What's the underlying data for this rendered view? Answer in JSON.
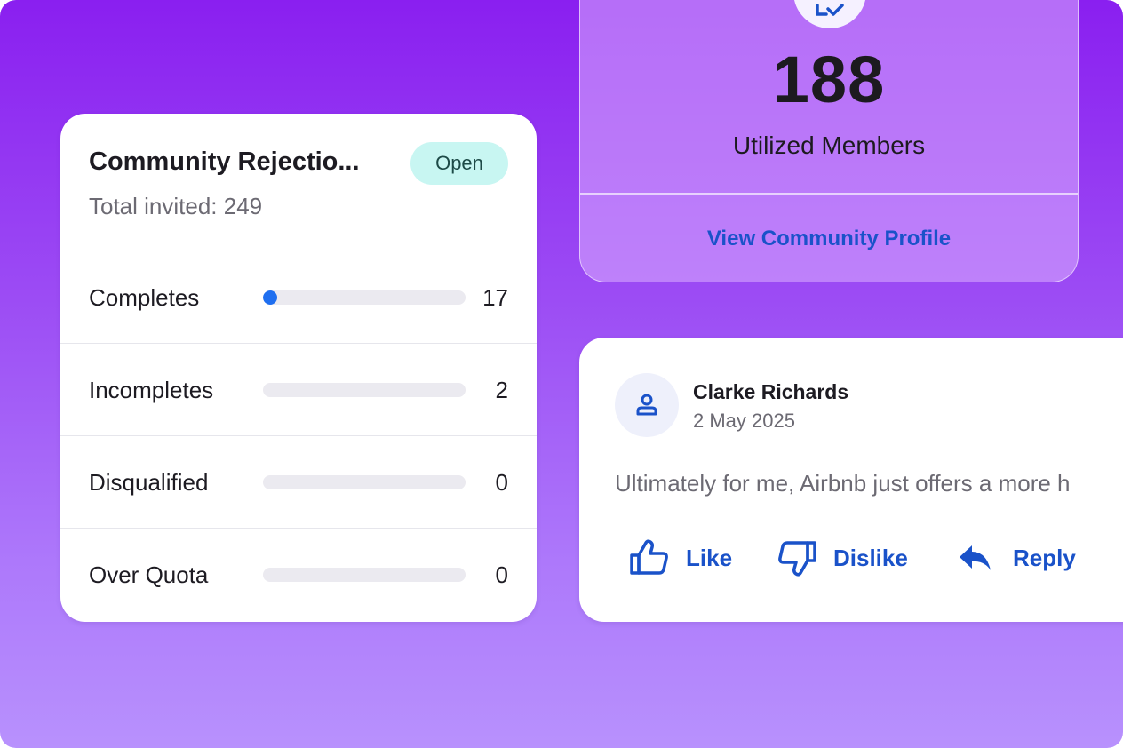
{
  "survey": {
    "title": "Community Rejectio...",
    "subtitle": "Total invited: 249",
    "status": "Open",
    "rows": [
      {
        "label": "Completes",
        "value": "17",
        "progress": 0.07
      },
      {
        "label": "Incompletes",
        "value": "2",
        "progress": 0
      },
      {
        "label": "Disqualified",
        "value": "0",
        "progress": 0
      },
      {
        "label": "Over Quota",
        "value": "0",
        "progress": 0
      }
    ]
  },
  "members": {
    "count": "188",
    "label": "Utilized Members",
    "link": "View Community Profile",
    "badge_icon": "members-check-icon"
  },
  "comment": {
    "author": "Clarke Richards",
    "date": "2 May 2025",
    "text": "Ultimately for me, Airbnb just offers a more h",
    "avatar_icon": "user-icon",
    "actions": {
      "like": "Like",
      "dislike": "Dislike",
      "reply": "Reply"
    }
  },
  "colors": {
    "accent": "#1a52c9",
    "progress": "#1f6ff0",
    "status_bg": "#c8f6f2",
    "gradient_top": "#8a1ff0",
    "gradient_bottom": "#b891fd"
  }
}
